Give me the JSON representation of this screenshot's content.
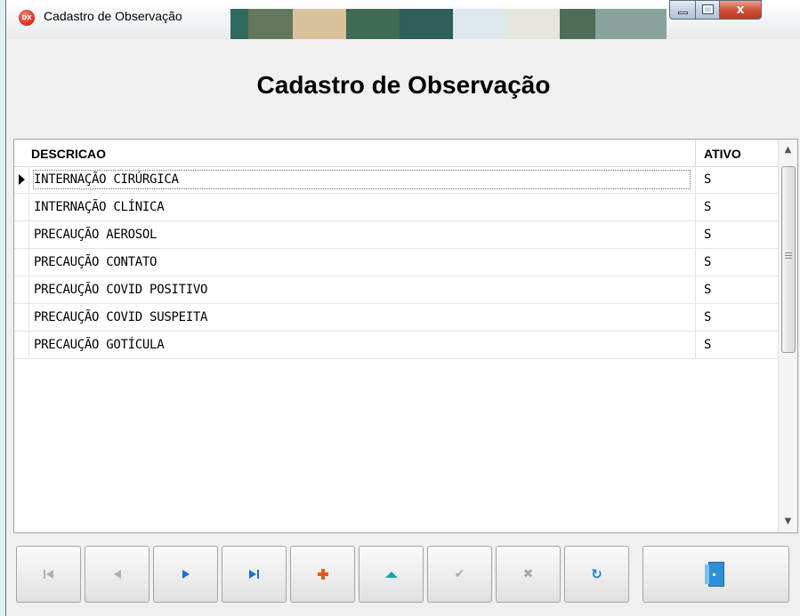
{
  "window": {
    "title": "Cadastro de Observação",
    "controls": {
      "close": "x"
    }
  },
  "header": {
    "title": "Cadastro de Observação"
  },
  "grid": {
    "columns": [
      "DESCRICAO",
      "ATIVO"
    ],
    "rows": [
      {
        "descricao": "INTERNAÇÃO CIRÚRGICA",
        "ativo": "S",
        "selected": true
      },
      {
        "descricao": "INTERNAÇÃO CLÍNICA",
        "ativo": "S"
      },
      {
        "descricao": "PRECAUÇÃO AEROSOL",
        "ativo": "S"
      },
      {
        "descricao": "PRECAUÇÃO CONTATO",
        "ativo": "S"
      },
      {
        "descricao": "PRECAUÇÃO COVID POSITIVO",
        "ativo": "S"
      },
      {
        "descricao": "PRECAUÇÃO COVID SUSPEITA",
        "ativo": "S"
      },
      {
        "descricao": "PRECAUÇÃO GOTÍCULA",
        "ativo": "S"
      }
    ]
  },
  "navigator": {
    "buttons": [
      {
        "name": "first",
        "icon": "first-record-icon",
        "enabled": false
      },
      {
        "name": "prior",
        "icon": "prior-record-icon",
        "enabled": false
      },
      {
        "name": "next",
        "icon": "next-record-icon",
        "enabled": true
      },
      {
        "name": "last",
        "icon": "last-record-icon",
        "enabled": true
      },
      {
        "name": "insert",
        "icon": "plus-icon",
        "enabled": true
      },
      {
        "name": "edit",
        "icon": "edit-triangle-icon",
        "enabled": true
      },
      {
        "name": "post",
        "icon": "check-icon",
        "enabled": false
      },
      {
        "name": "cancel",
        "icon": "x-icon",
        "enabled": false
      },
      {
        "name": "refresh",
        "icon": "refresh-icon",
        "enabled": true
      },
      {
        "name": "exit",
        "icon": "door-exit-icon",
        "enabled": true
      }
    ]
  },
  "colors": {
    "accent_blue": "#1a6fd6",
    "insert_orange": "#e4581b",
    "edit_teal": "#1aa3a8",
    "close_red": "#c0381f"
  }
}
